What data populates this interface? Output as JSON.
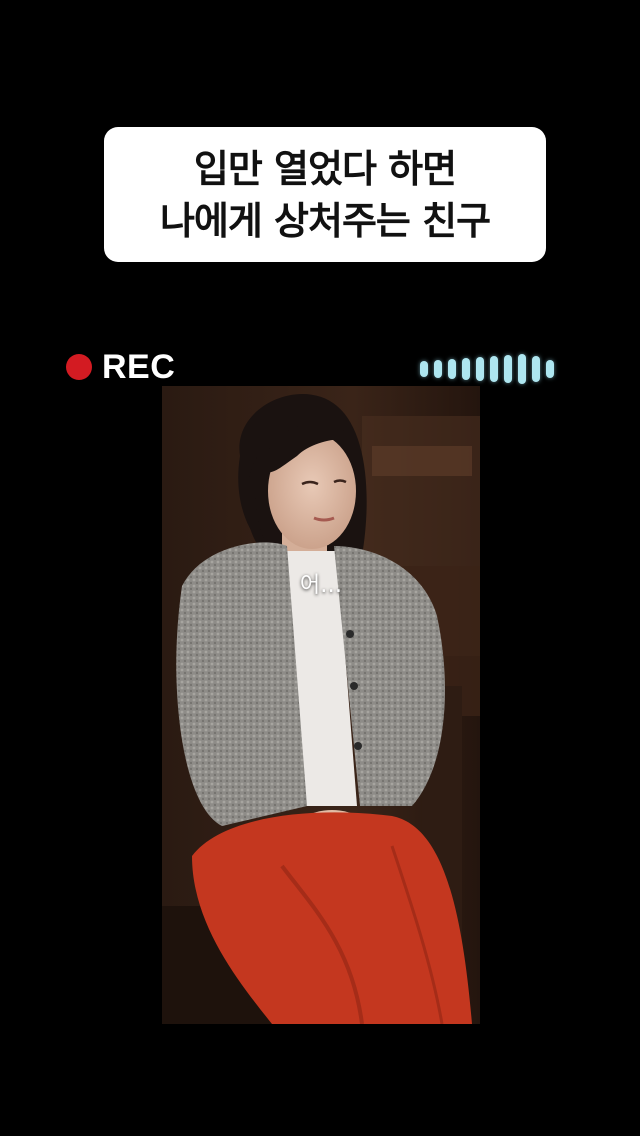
{
  "title": {
    "line1": "입만 열었다 하면",
    "line2": "나에게 상처주는 친구"
  },
  "recording": {
    "label": "REC",
    "indicator_color": "#d31b22",
    "audio_level_icon": "audio-level-meter-icon"
  },
  "video": {
    "caption": "어…"
  },
  "colors": {
    "background": "#000000",
    "card": "#ffffff",
    "meter": "#aee6f0",
    "skirt": "#c4371f",
    "cardigan": "#8c8a86"
  }
}
